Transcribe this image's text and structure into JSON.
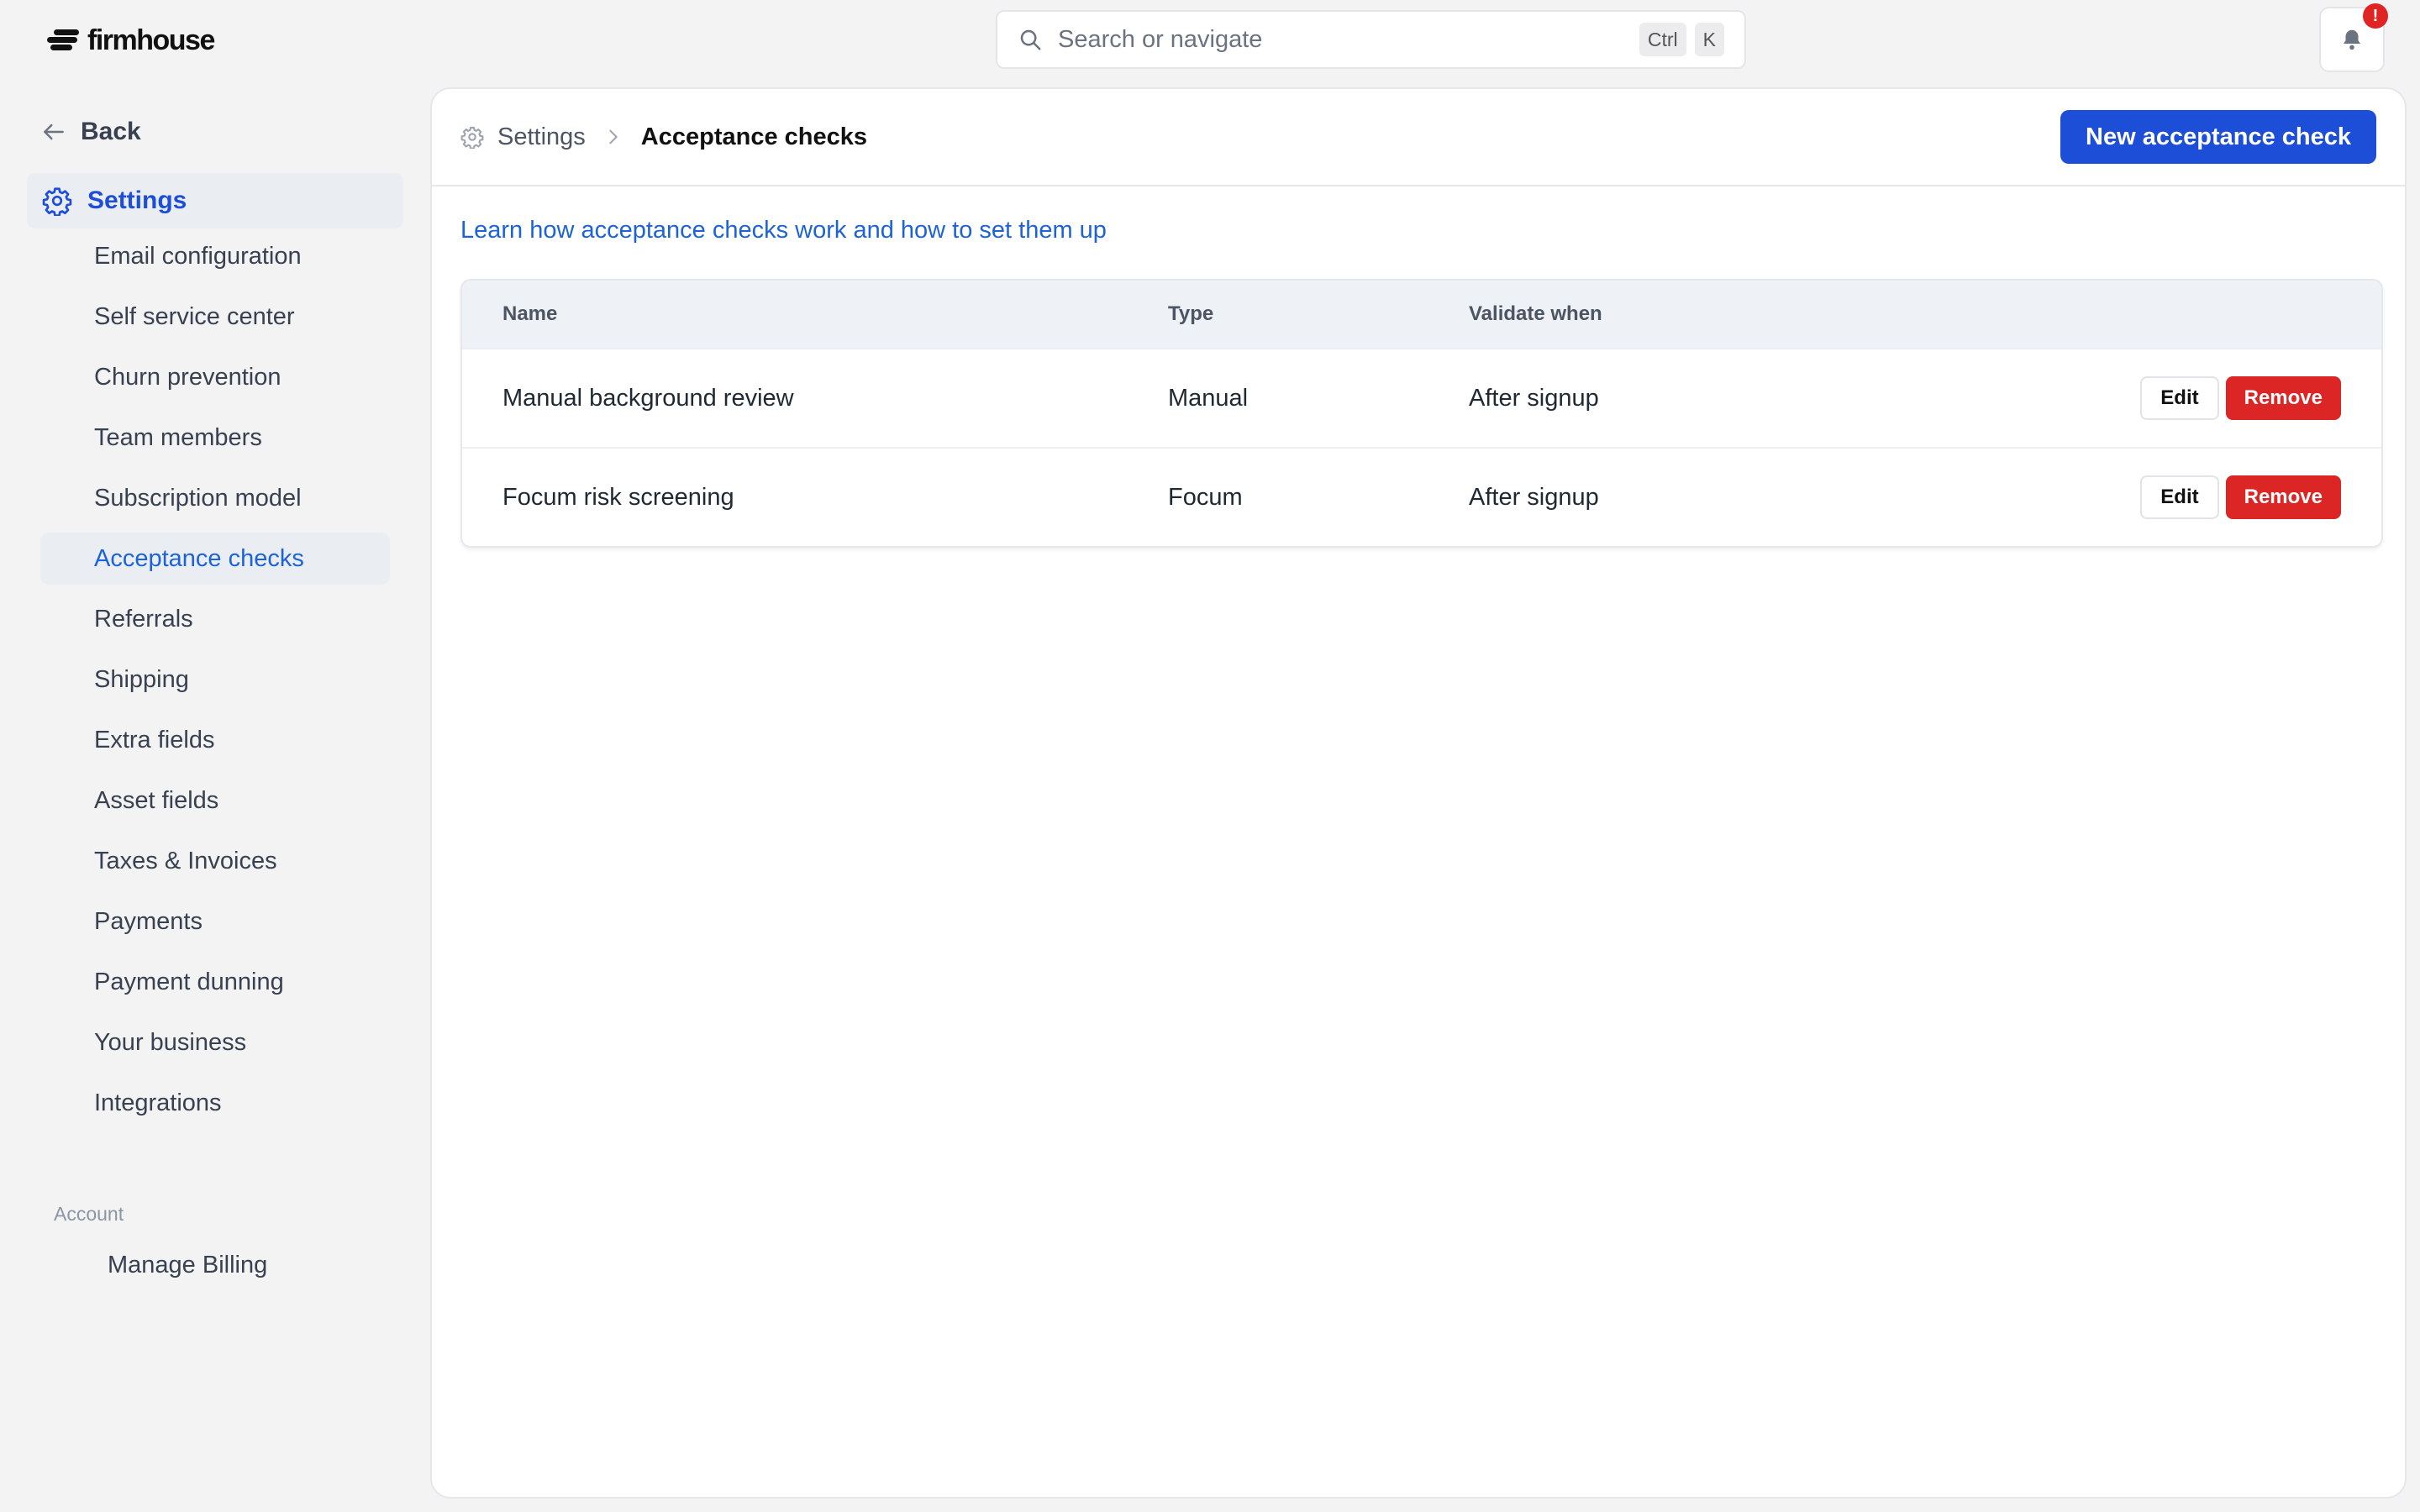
{
  "brand": {
    "name": "firmhouse"
  },
  "search": {
    "placeholder": "Search or navigate",
    "shortcut_mod": "Ctrl",
    "shortcut_key": "K"
  },
  "notifications": {
    "badge": "!"
  },
  "sidebar": {
    "back_label": "Back",
    "settings_label": "Settings",
    "items": [
      {
        "label": "Email configuration"
      },
      {
        "label": "Self service center"
      },
      {
        "label": "Churn prevention"
      },
      {
        "label": "Team members"
      },
      {
        "label": "Subscription model"
      },
      {
        "label": "Acceptance checks",
        "active": true
      },
      {
        "label": "Referrals"
      },
      {
        "label": "Shipping"
      },
      {
        "label": "Extra fields"
      },
      {
        "label": "Asset fields"
      },
      {
        "label": "Taxes & Invoices"
      },
      {
        "label": "Payments"
      },
      {
        "label": "Payment dunning"
      },
      {
        "label": "Your business"
      },
      {
        "label": "Integrations"
      }
    ],
    "account_section": "Account",
    "billing_label": "Manage Billing"
  },
  "header": {
    "breadcrumb_root": "Settings",
    "breadcrumb_current": "Acceptance checks",
    "new_button_label": "New acceptance check"
  },
  "main": {
    "learn_link": "Learn how acceptance checks work and how to set them up",
    "table": {
      "columns": {
        "name": "Name",
        "type": "Type",
        "validate_when": "Validate when"
      },
      "rows": [
        {
          "name": "Manual background review",
          "type": "Manual",
          "validate_when": "After signup",
          "edit": "Edit",
          "remove": "Remove"
        },
        {
          "name": "Focum risk screening",
          "type": "Focum",
          "validate_when": "After signup",
          "edit": "Edit",
          "remove": "Remove"
        }
      ]
    }
  },
  "colors": {
    "accent": "#1d4ed8",
    "danger": "#dc2626",
    "link": "#1d63d8",
    "badge": "#e02424"
  }
}
